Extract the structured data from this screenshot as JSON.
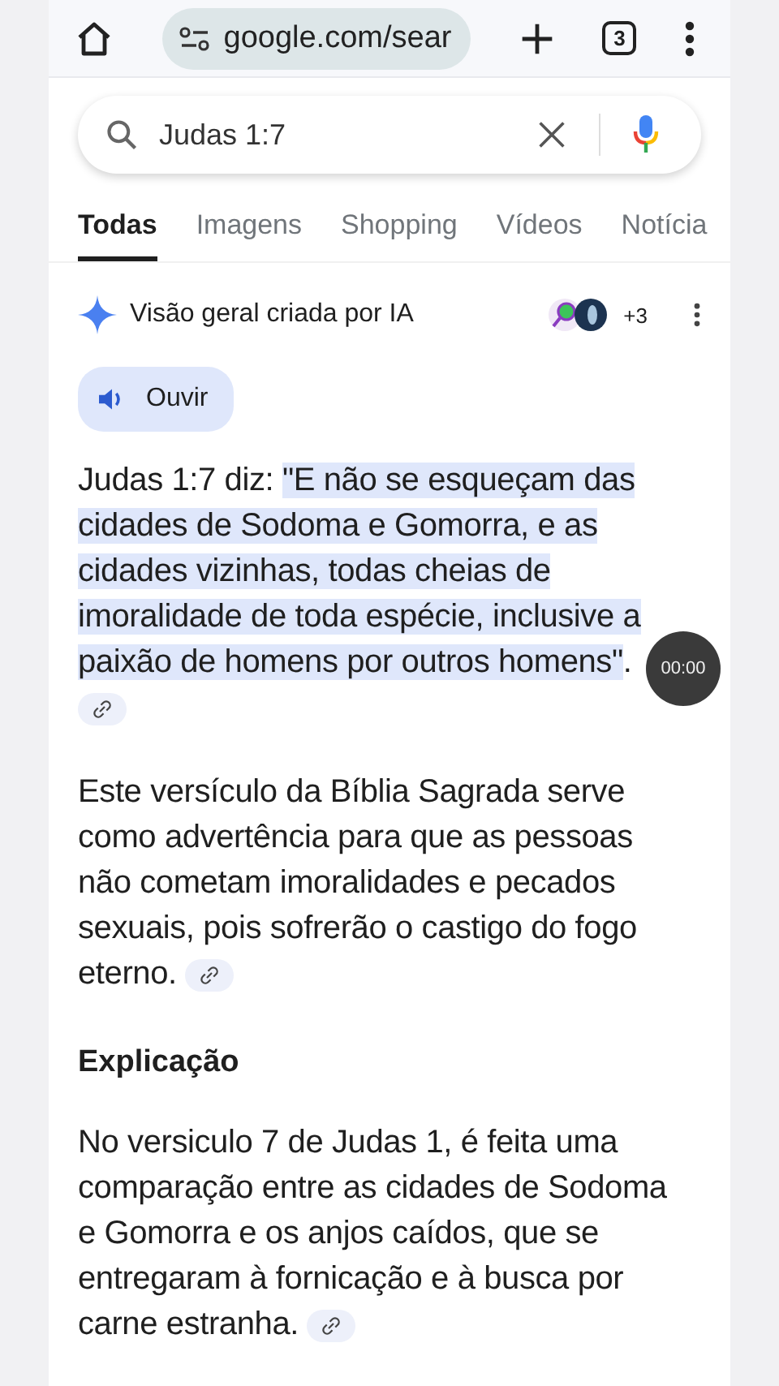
{
  "browser_bar": {
    "url": "google.com/sear",
    "tab_count": "3"
  },
  "search": {
    "value": "Judas 1:7"
  },
  "tabs": [
    {
      "label": "Todas",
      "selected": true
    },
    {
      "label": "Imagens",
      "selected": false
    },
    {
      "label": "Shopping",
      "selected": false
    },
    {
      "label": "Vídeos",
      "selected": false
    },
    {
      "label": "Notícia",
      "selected": false
    }
  ],
  "ai_overview": {
    "title": "Visão geral criada por IA",
    "sources_more": "+3",
    "listen_button": "Ouvir",
    "intro": "Judas 1:7 diz: ",
    "quote": "\"E não se esqueçam das cidades de Sodoma e Gomorra, e as cidades vizinhas, todas cheias de imoralidade de toda espécie, inclusive a paixão de homens por outros homens\"",
    "quote_end": ".",
    "paragraph": "Este versículo da Bíblia Sagrada serve como advertência para que as pessoas não cometam imoralidades e pecados sexuais, pois sofrerão o castigo do fogo eterno.",
    "heading": "Explicação",
    "explanation": "No versiculo 7 de Judas 1, é feita uma comparação entre as cidades de Sodoma e Gomorra e os anjos caídos, que se entregaram à fornicação e à busca por carne estranha."
  },
  "timer": "00:00"
}
